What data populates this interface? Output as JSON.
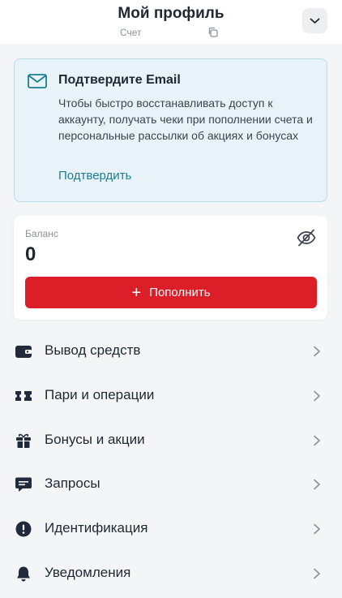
{
  "header": {
    "title": "Мой профиль",
    "subtitle": "Счет",
    "copy_icon": "copy-icon",
    "collapse_icon": "chevron-down-icon"
  },
  "email_card": {
    "icon": "mail-icon",
    "title": "Подтвердите Email",
    "text": "Чтобы быстро восстанавливать доступ к аккаунту, получать чеки при пополнении счета и персональные рассылки об акциях и бонусах",
    "link_label": "Подтвердить"
  },
  "balance": {
    "label": "Баланс",
    "value": "0",
    "visibility_icon": "eye-off-icon",
    "topup_label": "Пополнить",
    "topup_color": "#db1e27"
  },
  "menu": {
    "items": [
      {
        "label": "Вывод средств",
        "icon": "wallet-icon"
      },
      {
        "label": "Пари и операции",
        "icon": "ticket-icon"
      },
      {
        "label": "Бонусы и акции",
        "icon": "gift-icon"
      },
      {
        "label": "Запросы",
        "icon": "message-icon"
      },
      {
        "label": "Идентификация",
        "icon": "alert-icon"
      },
      {
        "label": "Уведомления",
        "icon": "bell-icon"
      }
    ]
  },
  "colors": {
    "accent_link": "#1a7e92",
    "card_bg": "#e8f3f9",
    "primary_red": "#db1e27",
    "icon_dark": "#1f2b3d"
  }
}
